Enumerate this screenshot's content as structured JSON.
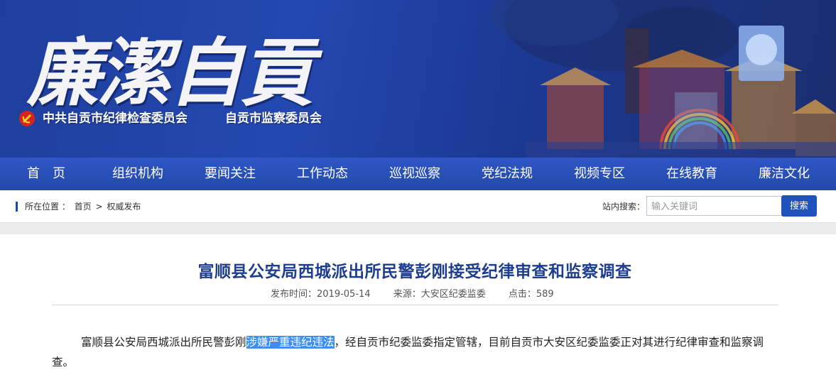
{
  "banner": {
    "title": "廉潔自貢",
    "org_1": "中共自贡市纪律检查委员会",
    "org_2": "自贡市监察委员会"
  },
  "nav": {
    "items": [
      "首　页",
      "组织机构",
      "要闻关注",
      "工作动态",
      "巡视巡察",
      "党纪法规",
      "视频专区",
      "在线教育",
      "廉洁文化"
    ]
  },
  "breadcrumb": {
    "prefix": "所在位置 ：",
    "home": "首页",
    "separator": ">",
    "current": "权威发布"
  },
  "search": {
    "label": "站内搜索：",
    "placeholder": "输入关键词",
    "button": "搜索"
  },
  "article": {
    "title": "富顺县公安局西城派出所民警彭刚接受纪律审查和监察调查",
    "publish_time": "发布时间：2019-05-14",
    "source": "来源：大安区纪委监委",
    "clicks": "点击：589",
    "body_before": "富顺县公安局西城派出所民警彭刚",
    "body_highlight": "涉嫌严重违纪违法",
    "body_after": "，经自贡市纪委监委指定管辖，目前自贡市大安区纪委监委正对其进行纪律审查和监察调查。"
  },
  "colors": {
    "nav_bg": "#2a50b8",
    "accent": "#1d3d8e",
    "search_button": "#1f52bd",
    "highlight": "#3b8ff0"
  }
}
